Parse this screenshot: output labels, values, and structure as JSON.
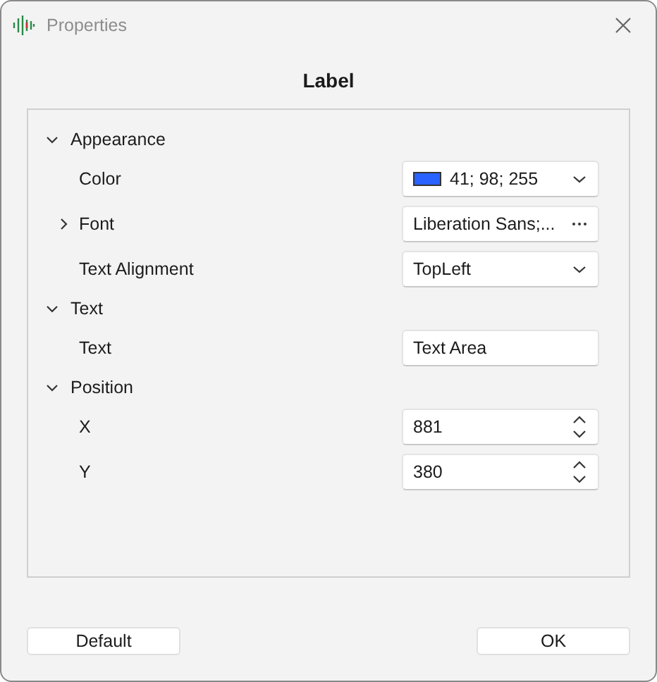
{
  "window": {
    "title": "Properties"
  },
  "heading": "Label",
  "categories": [
    {
      "label": "Appearance",
      "expanded": true,
      "properties": [
        {
          "label": "Color",
          "kind": "color",
          "value": "41; 98; 255",
          "color": "#2962ff"
        },
        {
          "label": "Font",
          "kind": "dialog",
          "value": "Liberation Sans;...",
          "expanded": false
        },
        {
          "label": "Text Alignment",
          "kind": "dropdown",
          "value": "TopLeft"
        }
      ]
    },
    {
      "label": "Text",
      "expanded": true,
      "properties": [
        {
          "label": "Text",
          "kind": "text",
          "value": "Text Area"
        }
      ]
    },
    {
      "label": "Position",
      "expanded": true,
      "properties": [
        {
          "label": "X",
          "kind": "spin",
          "value": "881"
        },
        {
          "label": "Y",
          "kind": "spin",
          "value": "380"
        }
      ]
    }
  ],
  "buttons": [
    {
      "label": "Default"
    },
    {
      "label": "OK"
    }
  ]
}
